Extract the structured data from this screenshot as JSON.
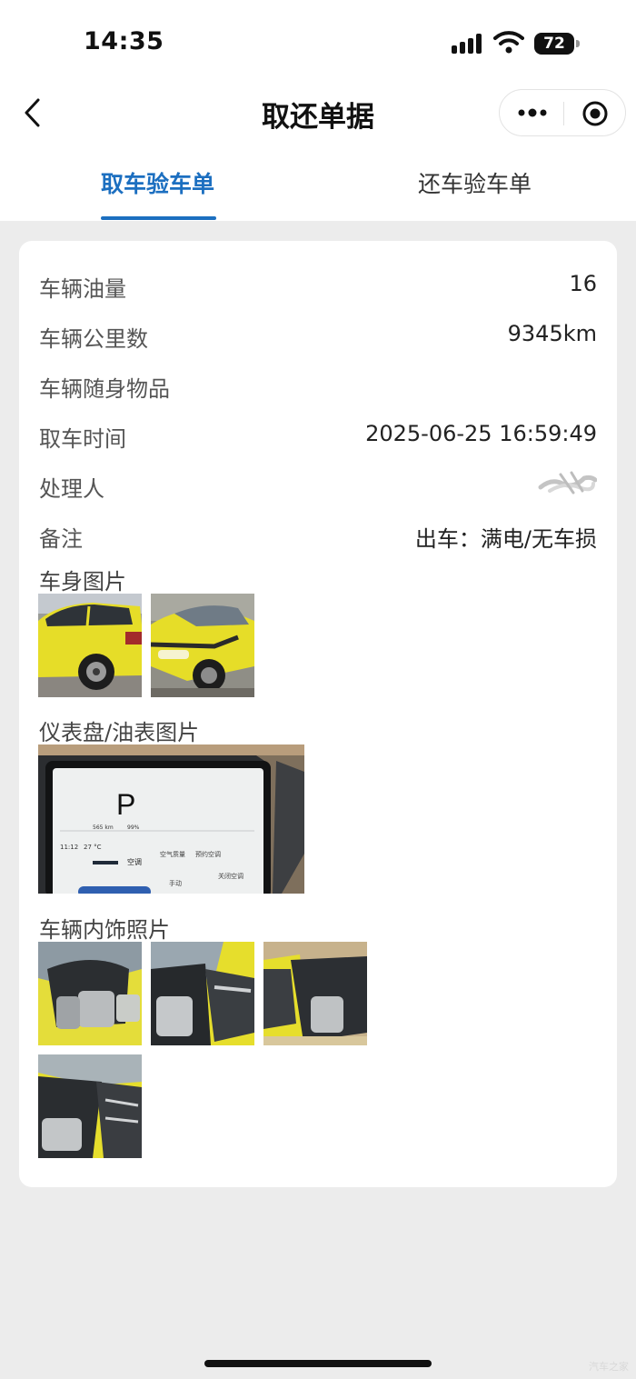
{
  "status_bar": {
    "time": "14:35",
    "battery": "72",
    "icons": [
      "signal-icon",
      "wifi-icon",
      "battery-icon"
    ]
  },
  "nav": {
    "title": "取还单据",
    "back_icon": "chevron-left-icon",
    "more_icon": "more-dots-icon",
    "close_icon": "target-icon"
  },
  "tabs": [
    {
      "label": "取车验车单",
      "active": true
    },
    {
      "label": "还车验车单",
      "active": false
    }
  ],
  "details": [
    {
      "label": "车辆油量",
      "value": "16"
    },
    {
      "label": "车辆公里数",
      "value": "9345km"
    },
    {
      "label": "车辆随身物品",
      "value": ""
    },
    {
      "label": "取车时间",
      "value": "2025-06-25 16:59:49"
    },
    {
      "label": "处理人",
      "value": ""
    },
    {
      "label": "备注",
      "value": "出车：满电/无车损"
    }
  ],
  "sections": {
    "body_photos": "车身图片",
    "dashboard_photos": "仪表盘/油表图片",
    "interior_photos": "车辆内饰照片"
  },
  "dashboard": {
    "gear": "P",
    "range": "565 km",
    "battery": "99%",
    "time": "11:12",
    "temperature": "27 °C",
    "tabs": [
      "空调",
      "空气质量",
      "预约空调"
    ],
    "mode": "手动",
    "off_label": "关闭空调"
  },
  "watermark": "汽车之家",
  "colors": {
    "accent": "#1c6fc0",
    "background": "#ececec",
    "card": "#ffffff",
    "car_yellow": "#e7de2a"
  }
}
